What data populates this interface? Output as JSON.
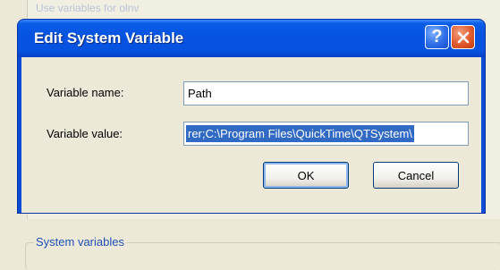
{
  "background": {
    "faded_label": "Use variables for olnv",
    "groupbox_label": "System variables"
  },
  "dialog": {
    "title": "Edit System Variable",
    "help_button_glyph": "?",
    "close_button_glyph": "✕",
    "fields": {
      "name_label": "Variable name:",
      "name_value": "Path",
      "value_label": "Variable value:",
      "value_value": "rer;C:\\Program Files\\QuickTime\\QTSystem\\"
    },
    "buttons": {
      "ok": "OK",
      "cancel": "Cancel"
    },
    "colors": {
      "titlebar": "#0553e0",
      "selection": "#316ac5",
      "close_button": "#e05a2c"
    }
  }
}
